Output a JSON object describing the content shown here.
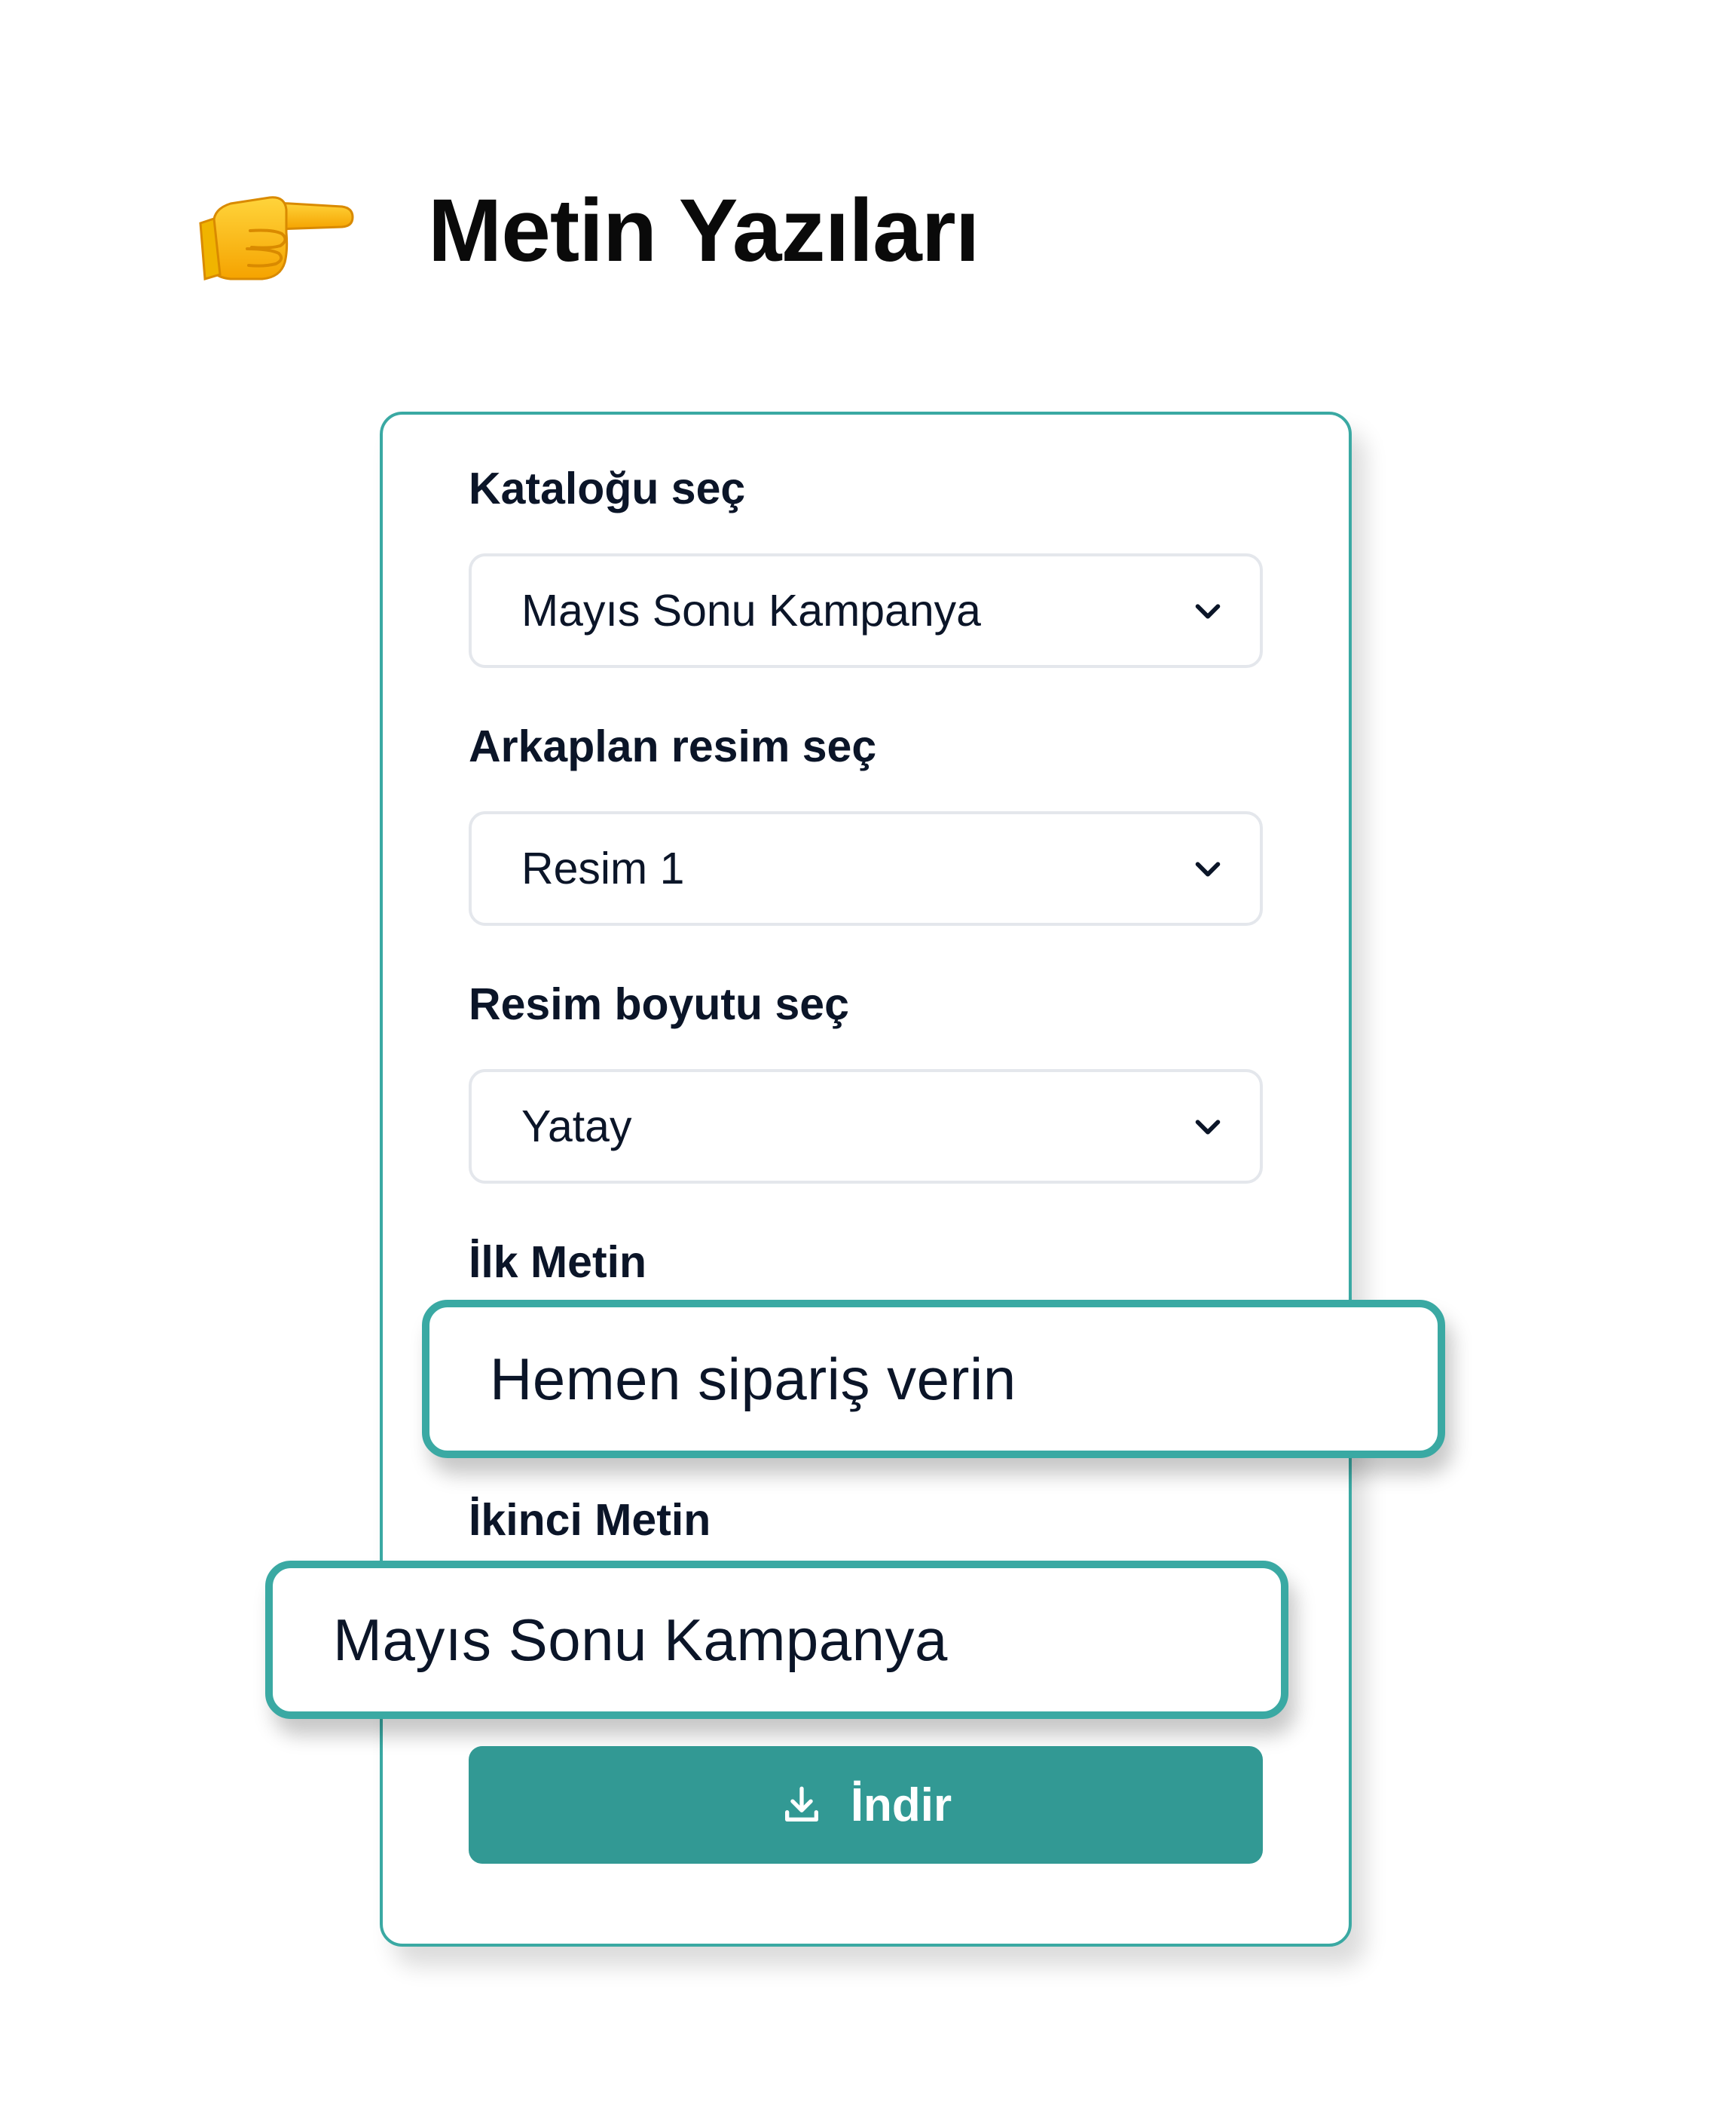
{
  "header": {
    "icon": "pointing-hand-icon",
    "title": "Metin Yazıları"
  },
  "form": {
    "catalog": {
      "label": "Kataloğu seç",
      "selected": "Mayıs Sonu Kampanya"
    },
    "background_image": {
      "label": "Arkaplan resim seç",
      "selected": "Resim 1"
    },
    "image_size": {
      "label": "Resim boyutu seç",
      "selected": "Yatay"
    },
    "first_text": {
      "label": "İlk Metin",
      "value": "Hemen sipariş verin"
    },
    "second_text": {
      "label": "İkinci Metin",
      "value": "Mayıs Sonu Kampanya"
    },
    "download": {
      "icon": "download-icon",
      "label": "İndir"
    }
  },
  "colors": {
    "accent": "#3aa9a3",
    "button": "#329994",
    "text": "#0b1528"
  }
}
